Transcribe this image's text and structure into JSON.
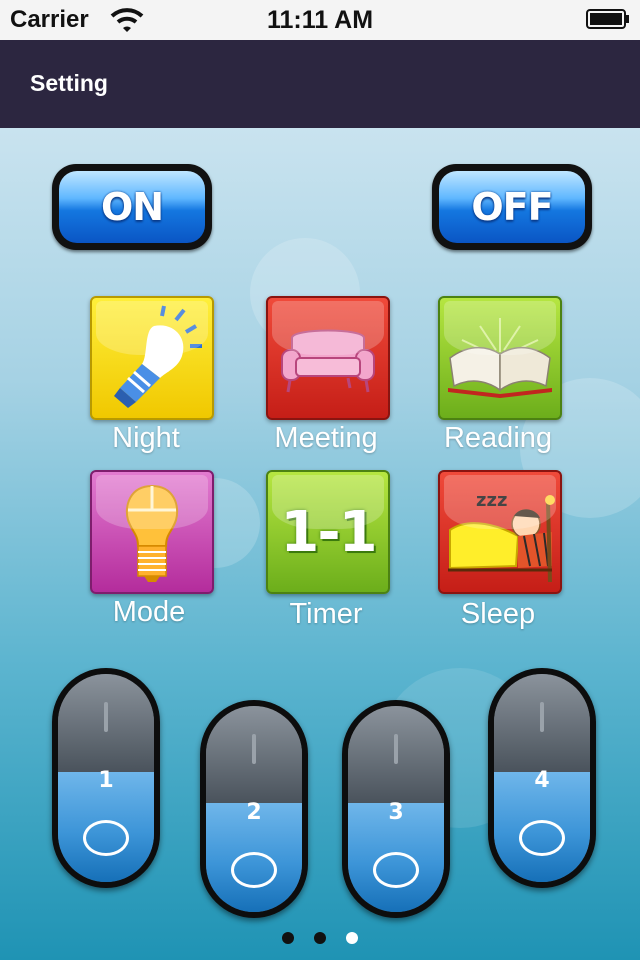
{
  "status_bar": {
    "carrier": "Carrier",
    "time": "11:11 AM"
  },
  "nav": {
    "title": "Setting"
  },
  "power": {
    "on_label": "ON",
    "off_label": "OFF"
  },
  "tiles": [
    {
      "label": "Night",
      "icon": "bulb-light-icon"
    },
    {
      "label": "Meeting",
      "icon": "sofa-icon"
    },
    {
      "label": "Reading",
      "icon": "open-book-icon"
    },
    {
      "label": "Mode",
      "icon": "bulb-mode-icon"
    },
    {
      "label": "Timer",
      "icon": "timer-icon"
    },
    {
      "label": "Sleep",
      "icon": "sleeping-person-icon"
    }
  ],
  "timer_icon_text": "1-1",
  "sleep_icon_text": "zzz",
  "sliders": [
    {
      "number": "1"
    },
    {
      "number": "2"
    },
    {
      "number": "3"
    },
    {
      "number": "4"
    }
  ],
  "page_indicator": {
    "count": 3,
    "active": 2
  },
  "colors": {
    "nav_bar": "#2c2640",
    "on_off_blue": "#1477e0"
  }
}
